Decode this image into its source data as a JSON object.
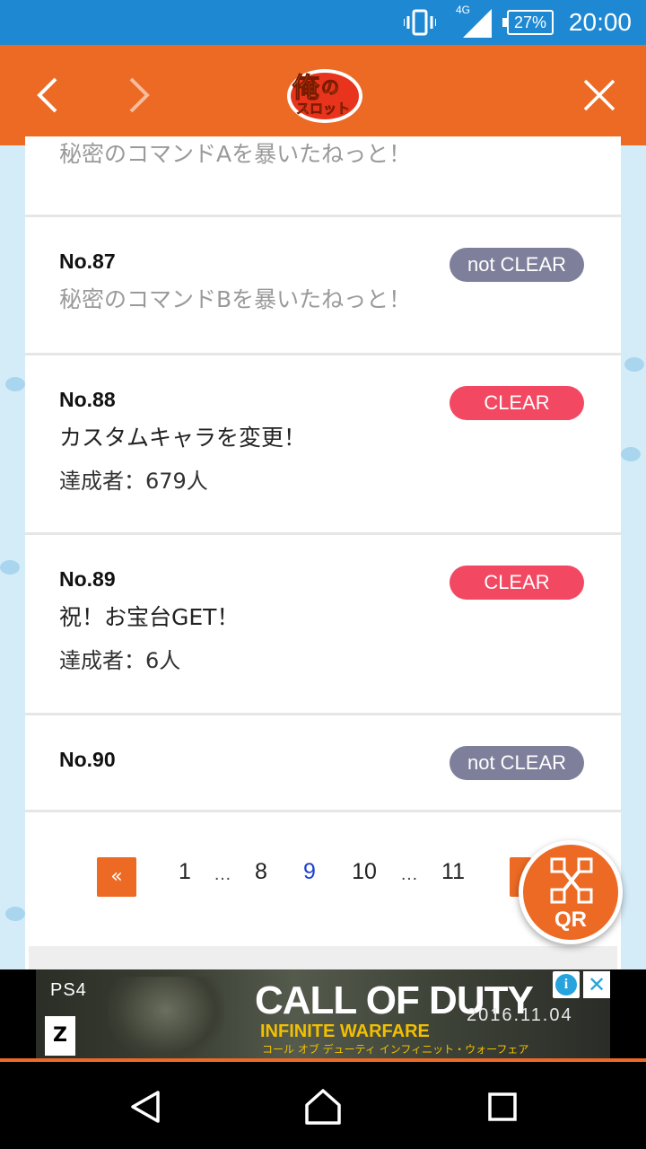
{
  "status_bar": {
    "time": "20:00",
    "battery": "27%",
    "network": "4G",
    "icons": [
      "vibrate-icon",
      "signal-icon",
      "battery-icon"
    ]
  },
  "header": {
    "logo_alt": "俺のスロット",
    "back_icon": "chevron-left-icon",
    "forward_icon": "chevron-right-icon",
    "close_icon": "close-icon"
  },
  "achievements": [
    {
      "number": "",
      "title": "秘密のコマンドAを暴いたねっと！",
      "count": "",
      "status": ""
    },
    {
      "number": "No.87",
      "title": "秘密のコマンドBを暴いたねっと！",
      "count": "",
      "status": "not CLEAR"
    },
    {
      "number": "No.88",
      "title": "カスタムキャラを変更！",
      "count": "達成者：679人",
      "status": "CLEAR"
    },
    {
      "number": "No.89",
      "title": "祝！お宝台GET！",
      "count": "達成者：6人",
      "status": "CLEAR"
    },
    {
      "number": "No.90",
      "title": "",
      "count": "",
      "status": "not CLEAR"
    }
  ],
  "pagination": {
    "prev": "«",
    "pages": [
      "1",
      "…",
      "8",
      "9",
      "10",
      "…",
      "11"
    ],
    "current": "9"
  },
  "qr_button": {
    "label": "QR"
  },
  "ad": {
    "platform": "PS4",
    "title": "CALL OF DUTY",
    "subtitle": "INFINITE WARFARE",
    "subtitle_jp": "コール オブ デューティ インフィニット・ウォーフェア",
    "date": "2016.11.04",
    "rating": "Z",
    "info": "i",
    "close": "✕"
  },
  "colors": {
    "header": "#ec6a24",
    "status_bar": "#1e88d3",
    "clear_badge": "#f34862",
    "not_clear_badge": "#7e7f9a",
    "active_page": "#1b3fd0"
  }
}
